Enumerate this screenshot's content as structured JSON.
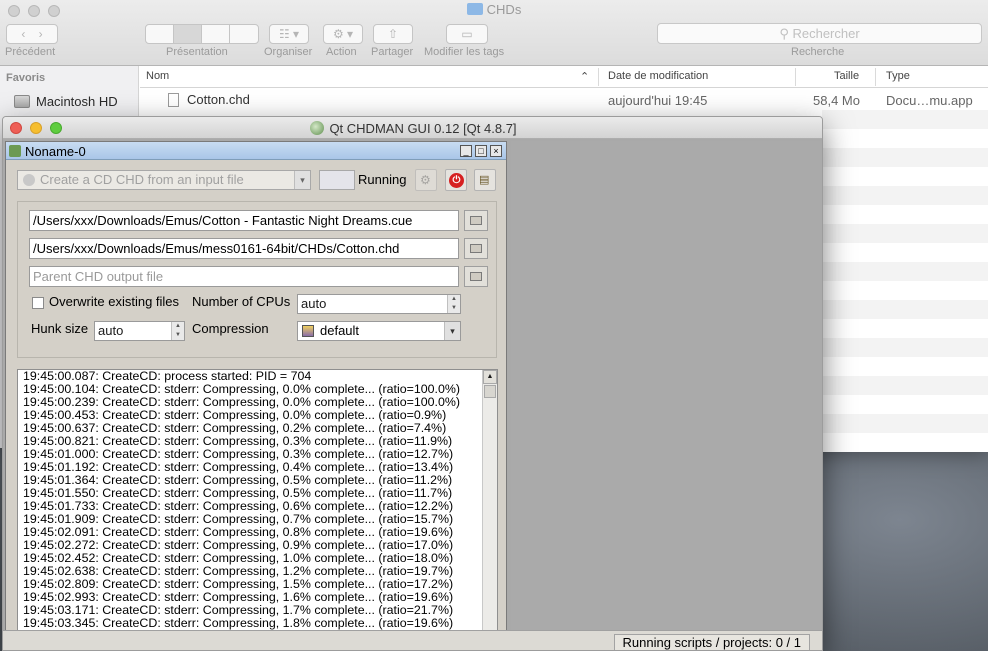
{
  "finder": {
    "title": "CHDs",
    "toolbar": {
      "back_label": "Précédent",
      "view_label": "Présentation",
      "arrange_label": "Organiser",
      "action_label": "Action",
      "share_label": "Partager",
      "tags_label": "Modifier les tags",
      "search_label": "Recherche",
      "search_placeholder": "Rechercher"
    },
    "sidebar": {
      "header": "Favoris",
      "items": [
        {
          "label": "Macintosh HD"
        }
      ]
    },
    "columns": {
      "name": "Nom",
      "date": "Date de modification",
      "size": "Taille",
      "type": "Type"
    },
    "files": [
      {
        "name": "Cotton.chd",
        "date": "aujourd'hui 19:45",
        "size": "58,4 Mo",
        "type": "Docu…mu.app"
      }
    ]
  },
  "qt": {
    "title": "Qt CHDMAN GUI 0.12 [Qt 4.8.7]",
    "subwindow": {
      "title": "Noname-0",
      "command_combo": "Create a CD CHD from an input file",
      "status": "Running",
      "input_file": "/Users/xxx/Downloads/Emus/Cotton - Fantastic Night Dreams.cue",
      "output_file": "/Users/xxx/Downloads/Emus/mess0161-64bit/CHDs/Cotton.chd",
      "parent_placeholder": "Parent CHD output file",
      "overwrite_label": "Overwrite existing files",
      "cpus_label": "Number of CPUs",
      "cpus_value": "auto",
      "hunk_label": "Hunk size",
      "hunk_value": "auto",
      "compression_label": "Compression",
      "compression_value": "default",
      "log": [
        "19:45:00.087: CreateCD: process started: PID = 704",
        "19:45:00.104: CreateCD: stderr: Compressing, 0.0% complete... (ratio=100.0%)",
        "19:45:00.239: CreateCD: stderr: Compressing, 0.0% complete... (ratio=100.0%)",
        "19:45:00.453: CreateCD: stderr: Compressing, 0.0% complete... (ratio=0.9%)",
        "19:45:00.637: CreateCD: stderr: Compressing, 0.2% complete... (ratio=7.4%)",
        "19:45:00.821: CreateCD: stderr: Compressing, 0.3% complete... (ratio=11.9%)",
        "19:45:01.000: CreateCD: stderr: Compressing, 0.3% complete... (ratio=12.7%)",
        "19:45:01.192: CreateCD: stderr: Compressing, 0.4% complete... (ratio=13.4%)",
        "19:45:01.364: CreateCD: stderr: Compressing, 0.5% complete... (ratio=11.2%)",
        "19:45:01.550: CreateCD: stderr: Compressing, 0.5% complete... (ratio=11.7%)",
        "19:45:01.733: CreateCD: stderr: Compressing, 0.6% complete... (ratio=12.2%)",
        "19:45:01.909: CreateCD: stderr: Compressing, 0.7% complete... (ratio=15.7%)",
        "19:45:02.091: CreateCD: stderr: Compressing, 0.8% complete... (ratio=19.6%)",
        "19:45:02.272: CreateCD: stderr: Compressing, 0.9% complete... (ratio=17.0%)",
        "19:45:02.452: CreateCD: stderr: Compressing, 1.0% complete... (ratio=18.0%)",
        "19:45:02.638: CreateCD: stderr: Compressing, 1.2% complete... (ratio=19.7%)",
        "19:45:02.809: CreateCD: stderr: Compressing, 1.5% complete... (ratio=17.2%)",
        "19:45:02.993: CreateCD: stderr: Compressing, 1.6% complete... (ratio=19.6%)",
        "19:45:03.171: CreateCD: stderr: Compressing, 1.7% complete... (ratio=21.7%)",
        "19:45:03.345: CreateCD: stderr: Compressing, 1.8% complete... (ratio=19.6%)"
      ]
    },
    "statusbar": "Running scripts / projects: 0 / 1"
  },
  "colors": {
    "stop_button": "#d62020",
    "subwindow_title": "#a9c6e8"
  }
}
